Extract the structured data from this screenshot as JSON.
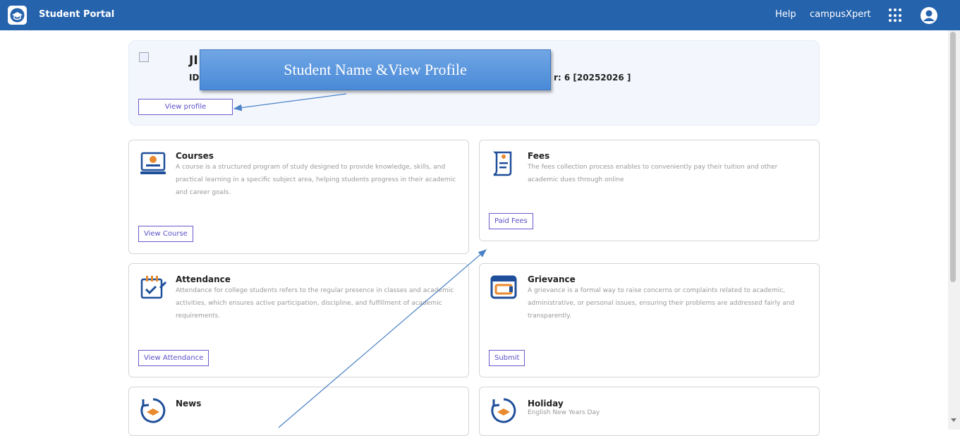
{
  "header": {
    "app_title": "Student Portal",
    "help_label": "Help",
    "brand_label": "campusXpert",
    "bg_color": "#2563ad"
  },
  "profile": {
    "name_partial": "JI",
    "id_label": "ID:",
    "semester_text": "r: 6 [20252026 ]",
    "view_profile_label": "View profile"
  },
  "callout": {
    "text": "Student Name &View Profile"
  },
  "cards": {
    "courses": {
      "title": "Courses",
      "desc": "A course is a structured program of study designed to provide knowledge, skills, and practical learning in a specific subject area, helping students progress in their academic and career goals.",
      "button": "View Course"
    },
    "fees": {
      "title": "Fees",
      "desc": "The fees collection process enables to conveniently pay their tuition and other academic dues through online",
      "button": "Paid Fees"
    },
    "attendance": {
      "title": "Attendance",
      "desc": "Attendance for college students refers to the regular presence in classes and academic activities, which ensures active participation, discipline, and fulfillment of academic requirements.",
      "button": "View Attendance"
    },
    "grievance": {
      "title": "Grievance",
      "desc": "A grievance is a formal way to raise concerns or complaints related to academic, administrative, or personal issues, ensuring their problems are addressed fairly and transparently.",
      "button": "Submit"
    },
    "news": {
      "title": "News"
    },
    "holiday": {
      "title": "Holiday",
      "desc": "English New Years Day"
    }
  },
  "icons": {
    "logo": "graduation-cap-icon",
    "apps": "apps-grid-icon",
    "user": "user-avatar-icon"
  },
  "colors": {
    "accent": "#5b4fc9",
    "callout": "#5b95dc",
    "icon_blue": "#1f4f9a",
    "icon_orange": "#e88a2d"
  }
}
